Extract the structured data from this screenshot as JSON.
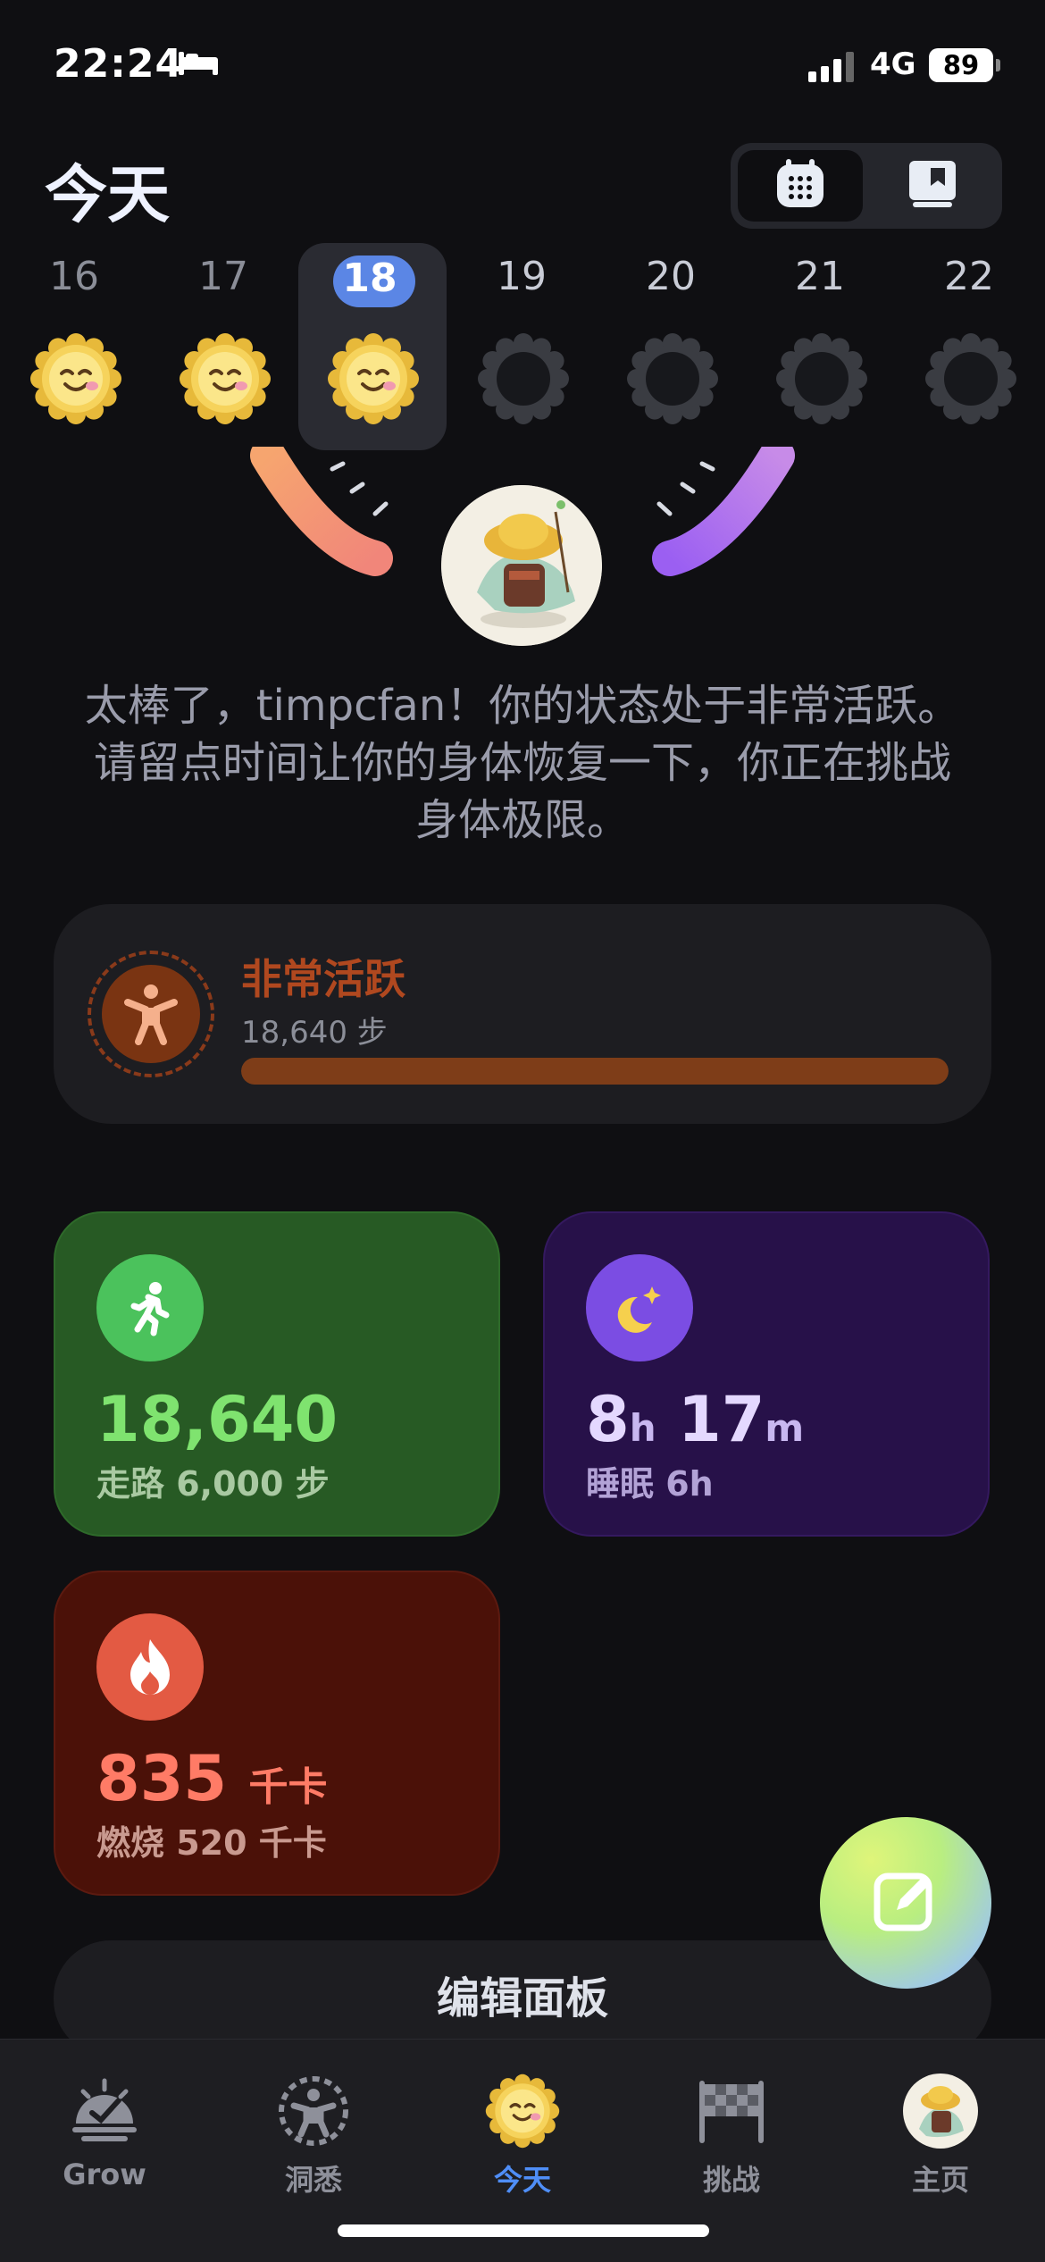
{
  "status": {
    "time": "22:24",
    "network": "4G",
    "battery": "89"
  },
  "header": {
    "title": "今天"
  },
  "week": [
    {
      "num": "16",
      "state": "happy"
    },
    {
      "num": "17",
      "state": "happy"
    },
    {
      "num": "18",
      "state": "happy",
      "selected": true
    },
    {
      "num": "19",
      "state": "empty"
    },
    {
      "num": "20",
      "state": "empty"
    },
    {
      "num": "21",
      "state": "empty"
    },
    {
      "num": "22",
      "state": "empty"
    }
  ],
  "hero": {
    "message": "太棒了，timpcfan！你的状态处于非常活跃。请留点时间让你的身体恢复一下，你正在挑战身体极限。"
  },
  "activity": {
    "title": "非常活跃",
    "steps": "18,640 步",
    "progress": 1.0
  },
  "tiles": {
    "steps": {
      "value": "18,640",
      "sub": "走路 6,000 步"
    },
    "sleep": {
      "h": "8",
      "h_unit": "h",
      "m": "17",
      "m_unit": "m",
      "sub": "睡眠 6h"
    },
    "calories": {
      "value": "835",
      "unit": "千卡",
      "sub": "燃烧 520 千卡"
    }
  },
  "edit_panel": "编辑面板",
  "tabs": [
    {
      "label": "Grow"
    },
    {
      "label": "洞悉"
    },
    {
      "label": "今天",
      "active": true
    },
    {
      "label": "挑战"
    },
    {
      "label": "主页"
    }
  ],
  "colors": {
    "accent": "#4f8ef7",
    "steps": "#7fe36f",
    "sleep": "#7b4de3",
    "calories": "#ff7b66",
    "activity": "#b0481f"
  },
  "icons": [
    "bed-icon",
    "signal-icon",
    "calendar-icon",
    "book-icon",
    "sun-face-icon",
    "person-icon",
    "walk-icon",
    "moon-icon",
    "flame-icon",
    "edit-icon",
    "grow-icon",
    "insight-icon",
    "flag-icon"
  ]
}
